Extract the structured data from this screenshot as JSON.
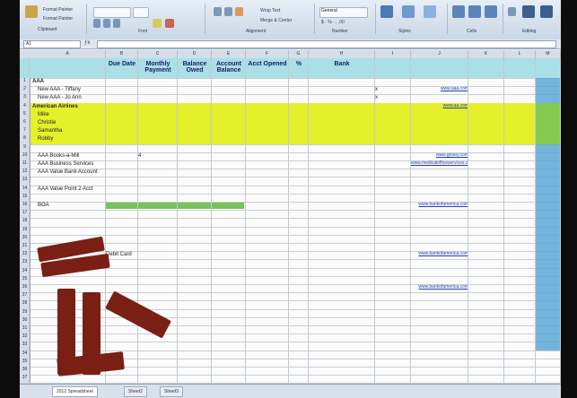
{
  "ribbon": {
    "groups": [
      "Clipboard",
      "Font",
      "Alignment",
      "Number",
      "Styles",
      "Cells",
      "Editing"
    ],
    "buttons": [
      "Paste",
      "Format Painter",
      "Wrap Text",
      "Merge & Center",
      "Conditional Formatting",
      "Format as Table",
      "Cell Styles",
      "Insert",
      "Delete",
      "Format",
      "AutoSum",
      "Fill",
      "Clear",
      "Sort & Filter",
      "Find & Select"
    ],
    "number_format": "General"
  },
  "namebox": "A1",
  "columns": [
    "A",
    "B",
    "C",
    "D",
    "E",
    "F",
    "G",
    "H",
    "I",
    "J",
    "K",
    "L",
    "M"
  ],
  "headers": {
    "due_date": "Due Date",
    "monthly_payment": "Monthly Payment",
    "balance_owed": "Balance Owed",
    "account_balance": "Account Balance",
    "acct_opened": "Acct Opened",
    "pct": "%",
    "bank": "Bank"
  },
  "rows": [
    {
      "n": "1",
      "a": "AAA",
      "b": "",
      "c": "",
      "d": "",
      "e": "",
      "f": "",
      "g": "",
      "h": "",
      "i": "",
      "j": "",
      "k": ""
    },
    {
      "n": "2",
      "a": "New AAA - Tiffany",
      "b": "",
      "c": "",
      "d": "",
      "e": "",
      "f": "",
      "g": "",
      "h": "",
      "i": "x",
      "j": "www.aaa.com",
      "k": ""
    },
    {
      "n": "3",
      "a": "New AAA - Jo Ann",
      "b": "",
      "c": "",
      "d": "",
      "e": "",
      "f": "",
      "g": "",
      "h": "",
      "i": "x",
      "j": "",
      "k": ""
    },
    {
      "n": "4",
      "a": "American Airlines",
      "b": "",
      "c": "",
      "d": "",
      "e": "",
      "f": "",
      "g": "",
      "h": "",
      "i": "",
      "j": "www.aa.com",
      "k": ""
    },
    {
      "n": "5",
      "a": "Mike",
      "b": "",
      "c": "",
      "d": "",
      "e": "",
      "f": "",
      "g": "",
      "h": "",
      "i": "",
      "j": "",
      "k": ""
    },
    {
      "n": "6",
      "a": "Christie",
      "b": "",
      "c": "",
      "d": "",
      "e": "",
      "f": "",
      "g": "",
      "h": "",
      "i": "",
      "j": "",
      "k": ""
    },
    {
      "n": "7",
      "a": "Samantha",
      "b": "",
      "c": "",
      "d": "",
      "e": "",
      "f": "",
      "g": "",
      "h": "",
      "i": "",
      "j": "",
      "k": ""
    },
    {
      "n": "8",
      "a": "Robby",
      "b": "",
      "c": "",
      "d": "",
      "e": "",
      "f": "",
      "g": "",
      "h": "",
      "i": "",
      "j": "",
      "k": ""
    },
    {
      "n": "9",
      "a": "",
      "b": "",
      "c": "",
      "d": "",
      "e": "",
      "f": "",
      "g": "",
      "h": "",
      "i": "",
      "j": "",
      "k": ""
    },
    {
      "n": "10",
      "a": "AAA Books-a-Mill",
      "b": "",
      "c": "4",
      "d": "",
      "e": "",
      "f": "",
      "g": "",
      "h": "",
      "i": "",
      "j": "www.gooey.com",
      "k": ""
    },
    {
      "n": "11",
      "a": "AAA Business Services",
      "b": "",
      "c": "",
      "d": "",
      "e": "",
      "f": "",
      "g": "",
      "h": "",
      "i": "",
      "j": "www.medicalofficeservices.com",
      "k": ""
    },
    {
      "n": "12",
      "a": "AAA Value Bank Account",
      "b": "",
      "c": "",
      "d": "",
      "e": "",
      "f": "",
      "g": "",
      "h": "",
      "i": "",
      "j": "",
      "k": ""
    },
    {
      "n": "13",
      "a": "",
      "b": "",
      "c": "",
      "d": "",
      "e": "",
      "f": "",
      "g": "",
      "h": "",
      "i": "",
      "j": "",
      "k": ""
    },
    {
      "n": "14",
      "a": "AAA Value Point 2 Acct",
      "b": "",
      "c": "",
      "d": "",
      "e": "",
      "f": "",
      "g": "",
      "h": "",
      "i": "",
      "j": "",
      "k": ""
    },
    {
      "n": "15",
      "a": "",
      "b": "",
      "c": "",
      "d": "",
      "e": "",
      "f": "",
      "g": "",
      "h": "",
      "i": "",
      "j": "",
      "k": ""
    },
    {
      "n": "16",
      "a": "BOA",
      "b": "",
      "c": "",
      "d": "",
      "e": "",
      "f": "",
      "g": "",
      "h": "",
      "i": "",
      "j": "www.bankofamerica.com",
      "k": ""
    },
    {
      "n": "17",
      "a": "",
      "b": "",
      "c": "",
      "d": "",
      "e": "",
      "f": "",
      "g": "",
      "h": "",
      "i": "",
      "j": "",
      "k": ""
    },
    {
      "n": "18",
      "a": "",
      "b": "",
      "c": "",
      "d": "",
      "e": "",
      "f": "",
      "g": "",
      "h": "",
      "i": "",
      "j": "",
      "k": ""
    },
    {
      "n": "19",
      "a": "",
      "b": "",
      "c": "",
      "d": "",
      "e": "",
      "f": "",
      "g": "",
      "h": "",
      "i": "",
      "j": "",
      "k": ""
    },
    {
      "n": "20",
      "a": "",
      "b": "",
      "c": "",
      "d": "",
      "e": "",
      "f": "",
      "g": "",
      "h": "",
      "i": "",
      "j": "",
      "k": ""
    },
    {
      "n": "21",
      "a": "",
      "b": "",
      "c": "",
      "d": "",
      "e": "",
      "f": "",
      "g": "",
      "h": "",
      "i": "",
      "j": "",
      "k": ""
    },
    {
      "n": "22",
      "a": "",
      "b": "Debit Card",
      "c": "",
      "d": "",
      "e": "",
      "f": "",
      "g": "",
      "h": "",
      "i": "",
      "j": "www.bankofamerica.com",
      "k": ""
    },
    {
      "n": "23",
      "a": "",
      "b": "",
      "c": "",
      "d": "",
      "e": "",
      "f": "",
      "g": "",
      "h": "",
      "i": "",
      "j": "",
      "k": ""
    },
    {
      "n": "24",
      "a": "",
      "b": "",
      "c": "",
      "d": "",
      "e": "",
      "f": "",
      "g": "",
      "h": "",
      "i": "",
      "j": "",
      "k": ""
    },
    {
      "n": "25",
      "a": "",
      "b": "",
      "c": "",
      "d": "",
      "e": "",
      "f": "",
      "g": "",
      "h": "",
      "i": "",
      "j": "",
      "k": ""
    },
    {
      "n": "26",
      "a": "",
      "b": "",
      "c": "",
      "d": "",
      "e": "",
      "f": "",
      "g": "",
      "h": "",
      "i": "",
      "j": "www.bankofamerica.com",
      "k": ""
    },
    {
      "n": "27",
      "a": "",
      "b": "",
      "c": "",
      "d": "",
      "e": "",
      "f": "",
      "g": "",
      "h": "",
      "i": "",
      "j": "",
      "k": ""
    },
    {
      "n": "28",
      "a": "",
      "b": "",
      "c": "",
      "d": "",
      "e": "",
      "f": "",
      "g": "",
      "h": "",
      "i": "",
      "j": "",
      "k": ""
    },
    {
      "n": "29",
      "a": "",
      "b": "",
      "c": "",
      "d": "",
      "e": "",
      "f": "",
      "g": "",
      "h": "",
      "i": "",
      "j": "",
      "k": ""
    },
    {
      "n": "30",
      "a": "",
      "b": "",
      "c": "",
      "d": "",
      "e": "",
      "f": "",
      "g": "",
      "h": "",
      "i": "",
      "j": "",
      "k": ""
    },
    {
      "n": "31",
      "a": "",
      "b": "",
      "c": "",
      "d": "",
      "e": "",
      "f": "",
      "g": "",
      "h": "",
      "i": "",
      "j": "",
      "k": ""
    },
    {
      "n": "32",
      "a": "",
      "b": "",
      "c": "",
      "d": "",
      "e": "",
      "f": "",
      "g": "",
      "h": "",
      "i": "",
      "j": "",
      "k": ""
    },
    {
      "n": "33",
      "a": "",
      "b": "",
      "c": "",
      "d": "",
      "e": "",
      "f": "",
      "g": "",
      "h": "",
      "i": "",
      "j": "",
      "k": ""
    },
    {
      "n": "34",
      "a": "",
      "b": "",
      "c": "",
      "d": "",
      "e": "",
      "f": "",
      "g": "",
      "h": "",
      "i": "",
      "j": "",
      "k": ""
    },
    {
      "n": "35",
      "a": "",
      "b": "",
      "c": "",
      "d": "",
      "e": "",
      "f": "",
      "g": "",
      "h": "",
      "i": "",
      "j": "",
      "k": ""
    },
    {
      "n": "36",
      "a": "",
      "b": "",
      "c": "",
      "d": "",
      "e": "",
      "f": "",
      "g": "",
      "h": "",
      "i": "",
      "j": "",
      "k": ""
    },
    {
      "n": "37",
      "a": "",
      "b": "",
      "c": "",
      "d": "",
      "e": "",
      "f": "",
      "g": "",
      "h": "",
      "i": "",
      "j": "",
      "k": ""
    }
  ],
  "sheet_tabs": [
    "2012 Spreadsheet",
    "Sheet2",
    "Sheet3"
  ],
  "colors": {
    "header_fill": "#a9e0e6",
    "yellow_fill": "#e4f02a",
    "green_fill": "#74c458",
    "blue_fill": "#5aa6d6",
    "redaction": "#7a1f14"
  }
}
